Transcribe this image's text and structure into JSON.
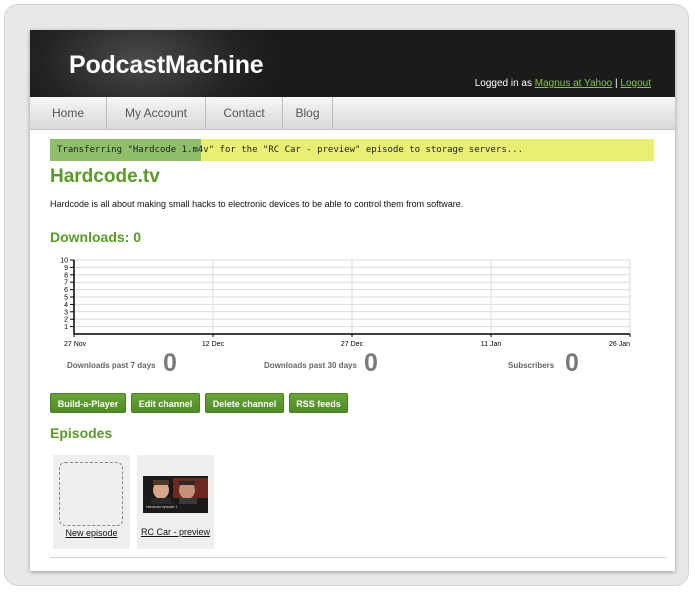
{
  "app": {
    "logo": "PodcastMachine"
  },
  "login": {
    "prefix": "Logged in as",
    "user": "Magnus at Yahoo",
    "separator": "|",
    "logout": "Logout"
  },
  "nav": {
    "items": [
      {
        "label": "Home"
      },
      {
        "label": "My Account"
      },
      {
        "label": "Contact"
      },
      {
        "label": "Blog"
      }
    ]
  },
  "progress": {
    "text": "Transferring \"Hardcode 1.m4v\" for the \"RC Car - preview\" episode to storage servers...",
    "fraction": 0.25,
    "fill_color": "#8fbf6a",
    "track_color": "#e8ef72"
  },
  "channel": {
    "title": "Hardcode.tv",
    "description": "Hardcode is all about making small hacks to electronic devices to be able to control them from software."
  },
  "downloads": {
    "heading": "Downloads: 0"
  },
  "chart_data": {
    "type": "line",
    "x_tick_labels": [
      "27 Nov",
      "12 Dec",
      "27 Dec",
      "11 Jan",
      "26 Jan"
    ],
    "y_ticks": [
      1,
      2,
      3,
      4,
      5,
      6,
      7,
      8,
      9,
      10
    ],
    "ylim": [
      0,
      10
    ],
    "grid": true,
    "series": [
      {
        "values": []
      }
    ]
  },
  "stats": {
    "week": {
      "label": "Downloads past 7 days",
      "value": "0"
    },
    "month": {
      "label": "Downloads past 30 days",
      "value": "0"
    },
    "subscribers": {
      "label": "Subscribers",
      "value": "0"
    }
  },
  "buttons": {
    "build": "Build-a-Player",
    "edit": "Edit channel",
    "delete": "Delete channel",
    "rss": "RSS feeds"
  },
  "episodes": {
    "heading": "Episodes",
    "new_label": "New episode",
    "items": [
      {
        "title": "RC Car - preview",
        "thumb_caption": "Hardcode episode 1"
      }
    ]
  },
  "colors": {
    "accent": "#5a9a2a",
    "header_bg": "#1f1f1f",
    "button": "#5a9a2a",
    "link": "#8bc34a"
  }
}
